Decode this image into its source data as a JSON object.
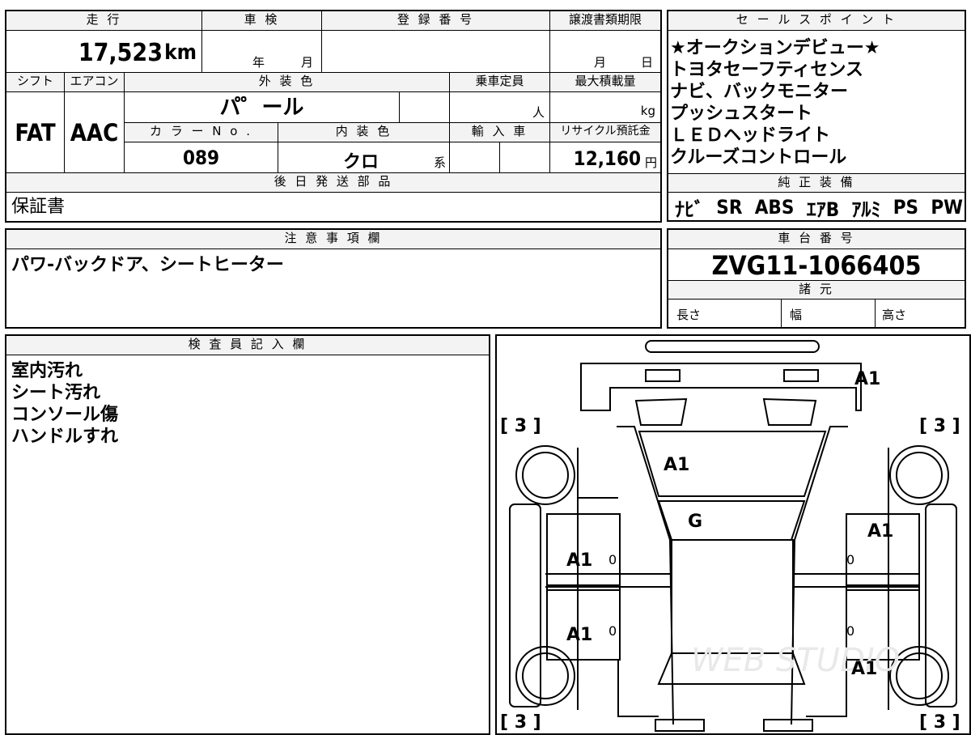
{
  "main_table": {
    "mileage": {
      "label": "走 行",
      "value": "17,523",
      "unit": "km"
    },
    "shaken": {
      "label": "車 検",
      "year_unit": "年",
      "month_unit": "月"
    },
    "registration": {
      "label": "登 録 番 号"
    },
    "transfer_deadline": {
      "label": "譲渡書類期限",
      "month_unit": "月",
      "day_unit": "日"
    },
    "shift": {
      "label": "シフト",
      "value": "FAT"
    },
    "aircon": {
      "label": "エアコン",
      "value": "AAC"
    },
    "exterior_color": {
      "label": "外 装 色",
      "value": "パ゜ール"
    },
    "capacity": {
      "label": "乗車定員",
      "unit": "人"
    },
    "max_load": {
      "label": "最大積載量",
      "unit": "kg"
    },
    "color_no": {
      "label": "カ ラ ー N o .",
      "value": "089"
    },
    "interior_color": {
      "label": "内 装 色",
      "value": "クロ",
      "suffix": "系"
    },
    "import": {
      "label": "輸 入 車"
    },
    "recycle": {
      "label": "リサイクル預託金",
      "value": "12,160",
      "unit": "円"
    },
    "later_parts": {
      "label": "後 日 発 送 部 品",
      "value": "保証書"
    }
  },
  "sales_points": {
    "label": "セ ー ル ス ポ イ ン ト",
    "items": [
      "★オークションデビュー★",
      "トヨタセーフティセンス",
      "ナビ、バックモニター",
      "プッシュスタート",
      "ＬＥＤヘッドライト",
      "クルーズコントロール"
    ]
  },
  "equipment": {
    "label": "純 正 装 備",
    "items": [
      "ﾅﾋﾞ",
      "SR",
      "ABS",
      "ｴｱB",
      "ｱﾙﾐ",
      "PS",
      "PW"
    ]
  },
  "notes": {
    "label": "注 意 事 項 欄",
    "text": "パワ-バックドア、シートヒーター"
  },
  "chassis": {
    "label": "車 台 番 号",
    "value": "ZVG11-1066405"
  },
  "specs": {
    "label": "諸 元",
    "length": "長さ",
    "width": "幅",
    "height": "高さ"
  },
  "inspector": {
    "label": "検 査 員 記 入 欄",
    "lines": [
      "室内汚れ",
      "シート汚れ",
      "コンソール傷",
      "ハンドルすれ"
    ]
  },
  "diagram": {
    "tire_marks": [
      "[ 3 ]",
      "[ 3 ]",
      "[ 3 ]",
      "[ 3 ]"
    ],
    "damage": [
      {
        "location": "rear-gate",
        "code": "A1"
      },
      {
        "location": "rear-glass",
        "code": "A1"
      },
      {
        "location": "roof",
        "code": "G"
      },
      {
        "location": "rear-left-door",
        "code": "A1"
      },
      {
        "location": "front-left-door",
        "code": "A1"
      },
      {
        "location": "rear-right-quarter",
        "code": "A1"
      },
      {
        "location": "front-right-fender",
        "code": "A1"
      }
    ],
    "zero_marks": [
      "0",
      "0",
      "0",
      "0"
    ],
    "watermark": "WEB STUDIO"
  }
}
